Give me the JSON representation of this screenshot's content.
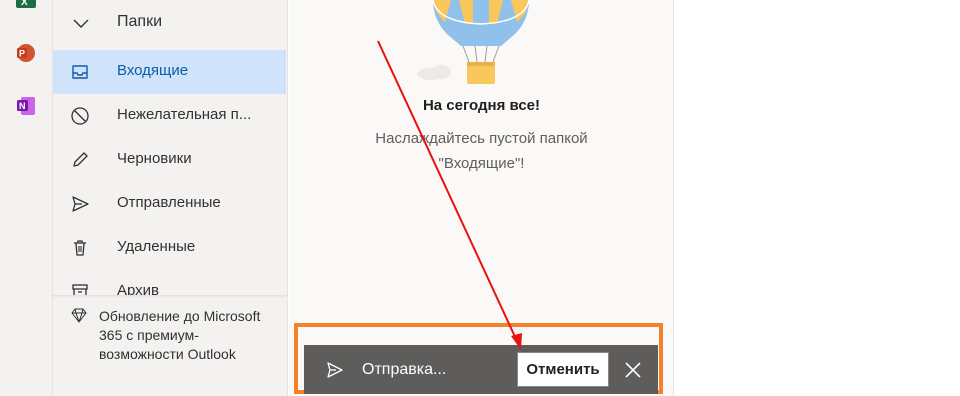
{
  "rail": {
    "apps": [
      {
        "name": "Excel",
        "icon": "excel-icon",
        "color": "#1d6f42"
      },
      {
        "name": "PowerPoint",
        "icon": "powerpoint-icon",
        "color": "#c43e1c",
        "letter": "P"
      },
      {
        "name": "OneNote",
        "icon": "onenote-icon",
        "color": "#7719aa",
        "letter": "N"
      }
    ]
  },
  "folders": {
    "header_label": "Папки",
    "items": [
      {
        "label": "Входящие",
        "icon": "inbox-icon",
        "selected": true
      },
      {
        "label": "Нежелательная п...",
        "icon": "junk-icon",
        "selected": false
      },
      {
        "label": "Черновики",
        "icon": "drafts-pencil-icon",
        "selected": false
      },
      {
        "label": "Отправленные",
        "icon": "sent-icon",
        "selected": false
      },
      {
        "label": "Удаленные",
        "icon": "trash-icon",
        "selected": false
      },
      {
        "label": "Архив",
        "icon": "archive-icon",
        "selected": false
      }
    ]
  },
  "upgrade": {
    "text": "Обновление до Microsoft 365 с премиум-возможности Outlook",
    "icon": "diamond-icon"
  },
  "empty_state": {
    "title": "На сегодня все!",
    "subtitle": "Наслаждайтесь пустой папкой \"Входящие\"!",
    "illustration": "hot-air-balloon-illustration"
  },
  "snackbar": {
    "status": "Отправка...",
    "undo_label": "Отменить",
    "send_icon": "send-icon",
    "close_icon": "close-icon"
  },
  "colors": {
    "selected_folder_bg": "#cfe4fa",
    "highlight_border": "#f4822a",
    "annotation_arrow": "#e8110f",
    "snackbar_bg": "#5e5d5b"
  }
}
